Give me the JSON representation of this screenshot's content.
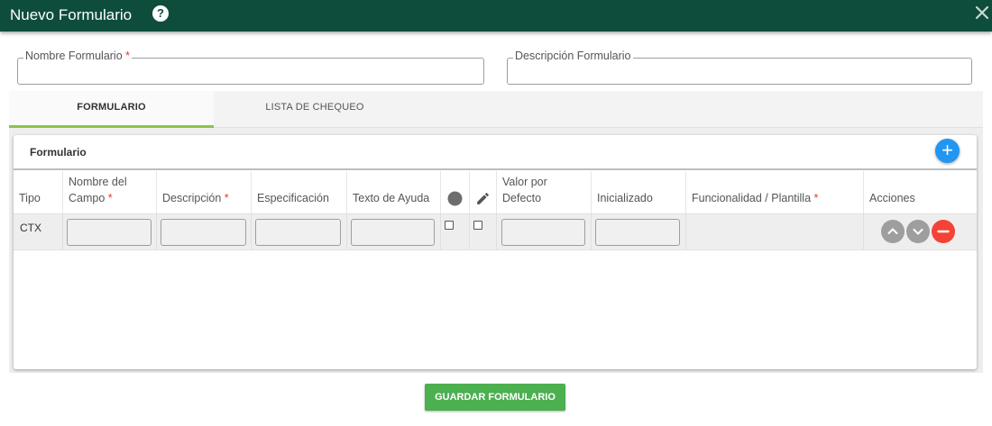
{
  "window": {
    "title": "Nuevo Formulario",
    "help_glyph": "?"
  },
  "fields": {
    "nombre": {
      "label": "Nombre Formulario",
      "required_mark": "*",
      "value": ""
    },
    "descripcion": {
      "label": "Descripción Formulario",
      "value": ""
    }
  },
  "tabs": [
    {
      "label": "FORMULARIO",
      "active": true
    },
    {
      "label": "LISTA DE CHEQUEO",
      "active": false
    }
  ],
  "card": {
    "title": "Formulario",
    "add_glyph": "+",
    "columns": {
      "tipo": "Tipo",
      "nombre_l1": "Nombre del",
      "nombre_l2": "Campo",
      "descripcion": "Descripción",
      "especificacion": "Especificación",
      "texto_ayuda": "Texto de Ayuda",
      "valor_l1": "Valor por",
      "valor_l2": "Defecto",
      "inicializado": "Inicializado",
      "funcionalidad": "Funcionalidad / Plantilla",
      "acciones": "Acciones",
      "required_mark": "*"
    },
    "rows": [
      {
        "tipo": "CTX"
      }
    ]
  },
  "icons": [
    "close-icon",
    "help-icon",
    "add-icon",
    "circle-icon",
    "pencil-icon",
    "chevron-up-icon",
    "chevron-down-icon",
    "minus-icon"
  ],
  "colors": {
    "header": "#0e4d3c",
    "tab_accent": "#8bc34a",
    "add": "#2196f3",
    "remove": "#f44336",
    "save": "#4caf50"
  },
  "save_button": {
    "label": "GUARDAR FORMULARIO"
  }
}
